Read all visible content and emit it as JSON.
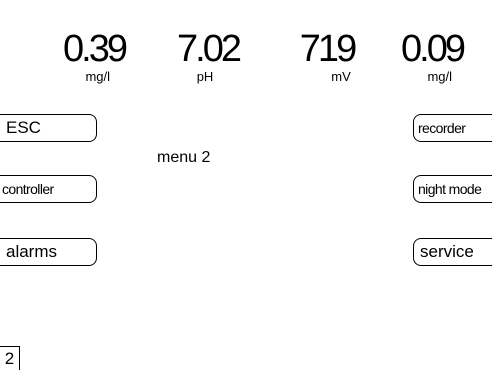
{
  "readings": [
    {
      "value": "0.39",
      "unit": "mg/l"
    },
    {
      "value": "7.02",
      "unit": "pH"
    },
    {
      "value": "719",
      "unit": "mV"
    },
    {
      "value": "0.09",
      "unit": "mg/l"
    }
  ],
  "menu": {
    "title": "menu 2"
  },
  "buttons": {
    "esc": "ESC",
    "controller": "controller",
    "alarms": "alarms",
    "recorder": "recorder",
    "night_mode": "night mode",
    "service": "service"
  },
  "page_indicator": "2"
}
